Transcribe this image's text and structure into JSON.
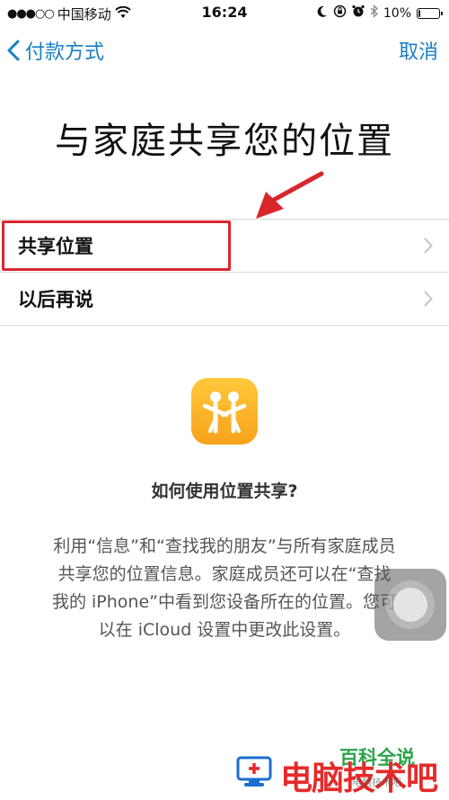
{
  "status_bar": {
    "signal": "●●●○○",
    "carrier": "中国移动",
    "time": "16:24",
    "battery_text": "10%",
    "battery_level": 0.1,
    "icons": [
      "wifi-icon",
      "moon-icon",
      "rotation-lock-icon",
      "alarm-icon",
      "bluetooth-icon",
      "battery-icon"
    ]
  },
  "nav": {
    "back_label": "付款方式",
    "cancel_label": "取消",
    "accent": "#1a7fc3"
  },
  "page": {
    "title": "与家庭共享您的位置"
  },
  "options": [
    {
      "label": "共享位置"
    },
    {
      "label": "以后再说"
    }
  ],
  "info": {
    "icon": "find-my-friends-icon",
    "question": "如何使用位置共享?",
    "description_lines": [
      "利用“信息”和“查找我的朋友”与所有家庭成员",
      "共享您的位置信息。家庭成员还可以在“查找",
      "我的 iPhone”中看到您设备所在的位置。您可",
      "以在 iCloud 设置中更改此设置。"
    ]
  },
  "watermark": {
    "green_text": "百科全说",
    "red_text": "电脑技术吧",
    "small_text": "电脑技术吧"
  },
  "colors": {
    "highlight": "#d9262c",
    "icon_gradient_top": "#ffc93a",
    "icon_gradient_bottom": "#f7a21b"
  }
}
